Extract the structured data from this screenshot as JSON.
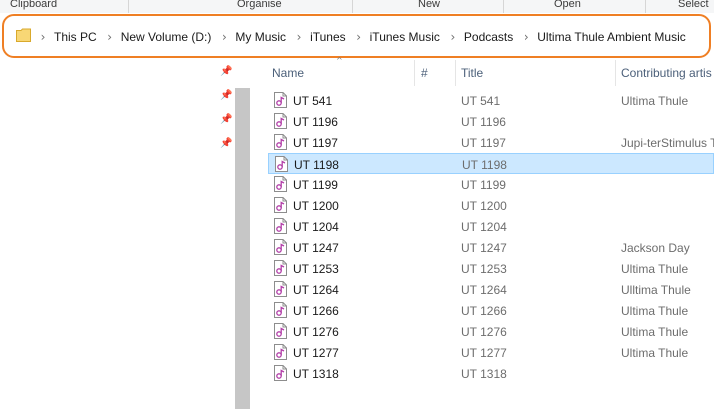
{
  "ribbon": {
    "groups": [
      {
        "label": "Clipboard"
      },
      {
        "label": "Organise"
      },
      {
        "label": "New"
      },
      {
        "label": "Open"
      },
      {
        "label": "Select"
      }
    ]
  },
  "address_bar": {
    "icon": "folder-icon",
    "highlight_color": "#ef7f24",
    "crumbs": [
      {
        "label": "This PC"
      },
      {
        "label": "New Volume (D:)"
      },
      {
        "label": "My Music"
      },
      {
        "label": "iTunes"
      },
      {
        "label": "iTunes Music"
      },
      {
        "label": "Podcasts"
      },
      {
        "label": "Ultima Thule Ambient Music"
      }
    ]
  },
  "nav_pane": {
    "pins": [
      "pin-icon",
      "pin-icon",
      "pin-icon",
      "pin-icon"
    ]
  },
  "columns": {
    "name": "Name",
    "number": "#",
    "title": "Title",
    "artist": "Contributing artis"
  },
  "selection_color": "#cce8ff",
  "files": [
    {
      "name": "UT 541",
      "title": "UT 541",
      "artist": "Ultima Thule"
    },
    {
      "name": "UT 1196",
      "title": "UT 1196",
      "artist": ""
    },
    {
      "name": "UT 1197",
      "title": "UT 1197",
      "artist": "Jupi-terStimulus T"
    },
    {
      "name": "UT 1198",
      "title": "UT 1198",
      "artist": "",
      "selected": true
    },
    {
      "name": "UT 1199",
      "title": "UT 1199",
      "artist": ""
    },
    {
      "name": "UT 1200",
      "title": "UT 1200",
      "artist": ""
    },
    {
      "name": "UT 1204",
      "title": "UT 1204",
      "artist": ""
    },
    {
      "name": "UT 1247",
      "title": "UT 1247",
      "artist": "Jackson Day"
    },
    {
      "name": "UT 1253",
      "title": "UT 1253",
      "artist": "Ultima Thule"
    },
    {
      "name": "UT 1264",
      "title": "UT 1264",
      "artist": "Ulltima Thule"
    },
    {
      "name": "UT 1266",
      "title": "UT 1266",
      "artist": "Ultima Thule"
    },
    {
      "name": "UT 1276",
      "title": "UT 1276",
      "artist": "Ultima Thule"
    },
    {
      "name": "UT 1277",
      "title": "UT 1277",
      "artist": "Ultima Thule"
    },
    {
      "name": "UT 1318",
      "title": "UT 1318",
      "artist": ""
    }
  ]
}
